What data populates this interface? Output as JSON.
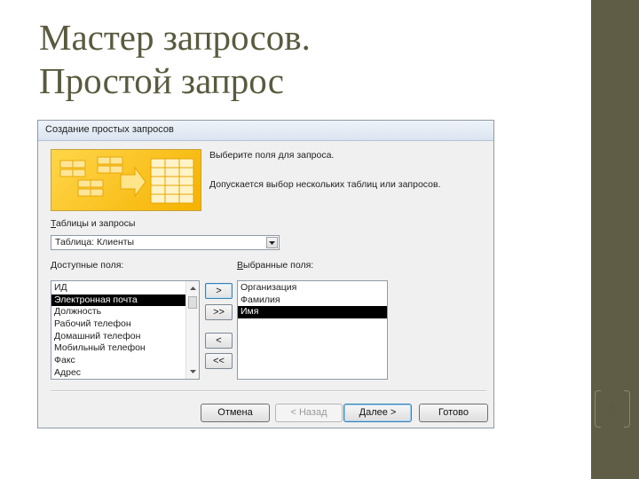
{
  "slide": {
    "title_line1": "Мастер запросов.",
    "title_line2": "Простой запрос",
    "page_number": "5"
  },
  "dialog": {
    "title": "Создание простых запросов",
    "instruction1": "Выберите поля для запроса.",
    "instruction2": "Допускается выбор нескольких таблиц или запросов.",
    "tables_label": "Таблицы и запросы",
    "tables_label_accel": "Т",
    "tables_label_rest": "аблицы и запросы",
    "table_select": "Таблица: Клиенты",
    "available_label_accel": "Д",
    "available_label_rest": "оступные поля:",
    "selected_label_accel": "В",
    "selected_label_rest": "ыбранные поля:",
    "available_fields": [
      "ИД",
      "Электронная почта",
      "Должность",
      "Рабочий телефон",
      "Домашний телефон",
      "Мобильный телефон",
      "Факс",
      "Адрес"
    ],
    "available_selected_index": 1,
    "selected_fields": [
      "Организация",
      "Фамилия",
      "Имя"
    ],
    "selected_selected_index": 2,
    "move_buttons": {
      "add_one": ">",
      "add_all": ">>",
      "remove_one": "<",
      "remove_all": "<<"
    },
    "buttons": {
      "cancel": "Отмена",
      "back": "< Назад",
      "next": "Далее >",
      "finish": "Готово"
    }
  },
  "colors": {
    "side_band": "#5f5d46",
    "title_text": "#5a5a3f",
    "art_yellow": "#f5b200",
    "selection": "#000000"
  }
}
